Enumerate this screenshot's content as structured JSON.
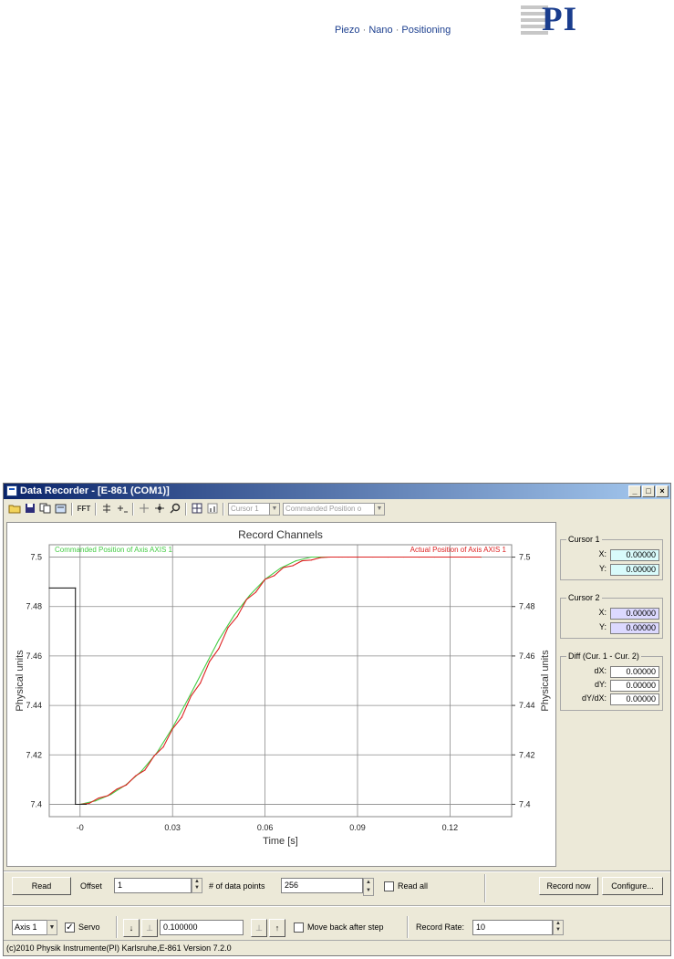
{
  "header": {
    "tagline_parts": [
      "Piezo",
      "Nano",
      "Positioning"
    ],
    "separator": "·",
    "logo": "PI"
  },
  "window": {
    "title": "Data Recorder - [E-861 (COM1)]",
    "controls": [
      "_",
      "□",
      "×"
    ]
  },
  "toolbar": {
    "icons": [
      "open-folder-icon",
      "save-icon",
      "copy-icon",
      "properties-icon",
      "fft-icon",
      "cursor-icon",
      "add-marker-icon",
      "move-icon",
      "pan-icon",
      "zoom-icon",
      "grid-icon",
      "bars-icon"
    ],
    "fft_label": "FFT",
    "cursor_select": "Cursor 1",
    "channel_select": "Commanded Position o"
  },
  "chart_data": {
    "type": "line",
    "title": "Record Channels",
    "xlabel": "Time [s]",
    "ylabel_left": "Physical units",
    "ylabel_right": "Physical units",
    "xlim": [
      -0.01,
      0.14
    ],
    "ylim": [
      7.395,
      7.505
    ],
    "x_ticks": [
      0,
      0.03,
      0.06,
      0.09,
      0.12
    ],
    "x_tick_labels": [
      "-0",
      "0.03",
      "0.06",
      "0.09",
      "0.12"
    ],
    "y_ticks": [
      7.4,
      7.42,
      7.44,
      7.46,
      7.48,
      7.5
    ],
    "y_tick_labels": [
      "7.4",
      "7.42",
      "7.44",
      "7.46",
      "7.48",
      "7.5"
    ],
    "grid": true,
    "series": [
      {
        "name": "Commanded Position of Axis AXIS 1",
        "color": "#44cc44",
        "legend_position": "top-left",
        "x": [
          0,
          0.005,
          0.01,
          0.015,
          0.02,
          0.025,
          0.03,
          0.035,
          0.04,
          0.045,
          0.05,
          0.055,
          0.06,
          0.065,
          0.07,
          0.075,
          0.08,
          0.085,
          0.09,
          0.095,
          0.1,
          0.105,
          0.11,
          0.115,
          0.12,
          0.125,
          0.13
        ],
        "y": [
          7.4,
          7.4014,
          7.404,
          7.408,
          7.4135,
          7.421,
          7.431,
          7.4425,
          7.4545,
          7.4665,
          7.4765,
          7.4845,
          7.491,
          7.4955,
          7.4985,
          7.5,
          7.5,
          7.5,
          7.5,
          7.5,
          7.5,
          7.5,
          7.5,
          7.5,
          7.5,
          7.5,
          7.5
        ]
      },
      {
        "name": "Actual Position of Axis AXIS 1",
        "color": "#dd2222",
        "legend_position": "top-right",
        "x": [
          0,
          0.003,
          0.006,
          0.009,
          0.012,
          0.015,
          0.018,
          0.021,
          0.024,
          0.027,
          0.03,
          0.033,
          0.036,
          0.039,
          0.042,
          0.045,
          0.048,
          0.051,
          0.054,
          0.057,
          0.06,
          0.063,
          0.066,
          0.069,
          0.072,
          0.075,
          0.078,
          0.081,
          0.084,
          0.087,
          0.09,
          0.1,
          0.11,
          0.12,
          0.13
        ],
        "y": [
          7.4,
          7.4004,
          7.4025,
          7.4035,
          7.4062,
          7.4078,
          7.4115,
          7.4138,
          7.4195,
          7.4232,
          7.4305,
          7.4352,
          7.4438,
          7.449,
          7.4578,
          7.463,
          7.4715,
          7.476,
          7.4828,
          7.4858,
          7.491,
          7.4925,
          7.4958,
          7.4965,
          7.4985,
          7.4988,
          7.4998,
          7.5,
          7.5,
          7.5,
          7.5,
          7.5,
          7.5,
          7.5,
          7.5
        ]
      },
      {
        "name": "",
        "color": "#222222",
        "x": [
          -0.01,
          -0.0015,
          -0.0015,
          0.002
        ],
        "y": [
          7.4875,
          7.4875,
          7.4,
          7.4
        ]
      }
    ]
  },
  "cursor1": {
    "title": "Cursor 1",
    "x_label": "X:",
    "y_label": "Y:",
    "x": "0.00000",
    "y": "0.00000"
  },
  "cursor2": {
    "title": "Cursor 2",
    "x_label": "X:",
    "y_label": "Y:",
    "x": "0.00000",
    "y": "0.00000"
  },
  "diff": {
    "title": "Diff (Cur. 1 - Cur. 2)",
    "dx_label": "dX:",
    "dy_label": "dY:",
    "dydx_label": "dY/dX:",
    "dx": "0.00000",
    "dy": "0.00000",
    "dydx": "0.00000"
  },
  "controls": {
    "read_label": "Read",
    "offset_label": "Offset",
    "offset_value": "1",
    "points_label": "# of data points",
    "points_value": "256",
    "read_all_label": "Read all",
    "record_now_label": "Record now",
    "configure_label": "Configure...",
    "axis_value": "Axis 1",
    "servo_label": "Servo",
    "step_value": "0.100000",
    "move_back_label": "Move back after step",
    "record_rate_label": "Record Rate:",
    "record_rate_value": "10"
  },
  "status": "(c)2010 Physik Instrumente(PI) Karlsruhe,E-861 Version 7.2.0"
}
